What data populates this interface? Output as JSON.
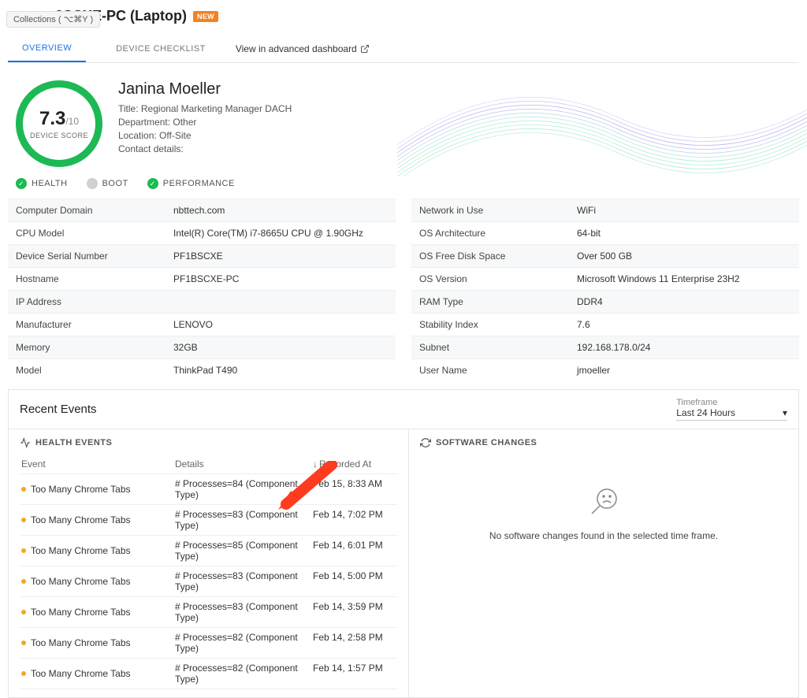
{
  "header": {
    "tooltip": "Collections ( ⌥⌘Y )",
    "device_title": "3SCXE-PC (Laptop)",
    "new_badge": "NEW"
  },
  "tabs": {
    "overview": "OVERVIEW",
    "checklist": "DEVICE CHECKLIST",
    "advanced_link": "View in advanced dashboard"
  },
  "score": {
    "value": "7.3",
    "max": "/10",
    "label": "DEVICE SCORE"
  },
  "user": {
    "name": "Janina Moeller",
    "title_line": "Title: Regional Marketing Manager DACH",
    "dept_line": "Department: Other",
    "location_line": "Location: Off-Site",
    "contact_line": "Contact details:"
  },
  "status": {
    "health": "HEALTH",
    "boot": "BOOT",
    "performance": "PERFORMANCE"
  },
  "props_left": [
    {
      "label": "Computer Domain",
      "value": "nbttech.com"
    },
    {
      "label": "CPU Model",
      "value": "Intel(R) Core(TM) i7-8665U CPU @ 1.90GHz"
    },
    {
      "label": "Device Serial Number",
      "value": "PF1BSCXE"
    },
    {
      "label": "Hostname",
      "value": "PF1BSCXE-PC"
    },
    {
      "label": "IP Address",
      "value": ""
    },
    {
      "label": "Manufacturer",
      "value": "LENOVO"
    },
    {
      "label": "Memory",
      "value": "32GB"
    },
    {
      "label": "Model",
      "value": "ThinkPad T490"
    }
  ],
  "props_right": [
    {
      "label": "Network in Use",
      "value": "WiFi"
    },
    {
      "label": "OS Architecture",
      "value": "64-bit"
    },
    {
      "label": "OS Free Disk Space",
      "value": "Over 500 GB"
    },
    {
      "label": "OS Version",
      "value": "Microsoft Windows 11 Enterprise 23H2"
    },
    {
      "label": "RAM Type",
      "value": "DDR4"
    },
    {
      "label": "Stability Index",
      "value": "7.6"
    },
    {
      "label": "Subnet",
      "value": "192.168.178.0/24"
    },
    {
      "label": "User Name",
      "value": "jmoeller"
    }
  ],
  "events_panel": {
    "title": "Recent Events",
    "timeframe_label": "Timeframe",
    "timeframe_value": "Last 24 Hours",
    "health_title": "HEALTH EVENTS",
    "changes_title": "SOFTWARE CHANGES",
    "col_event": "Event",
    "col_details": "Details",
    "col_time": "Recorded At",
    "empty_changes": "No software changes found in the selected time frame.",
    "rows": [
      {
        "event": "Too Many Chrome Tabs",
        "details": "# Processes=84 (Component Type)",
        "time": "Feb 15, 8:33 AM"
      },
      {
        "event": "Too Many Chrome Tabs",
        "details": "# Processes=83 (Component Type)",
        "time": "Feb 14, 7:02 PM"
      },
      {
        "event": "Too Many Chrome Tabs",
        "details": "# Processes=85 (Component Type)",
        "time": "Feb 14, 6:01 PM"
      },
      {
        "event": "Too Many Chrome Tabs",
        "details": "# Processes=83 (Component Type)",
        "time": "Feb 14, 5:00 PM"
      },
      {
        "event": "Too Many Chrome Tabs",
        "details": "# Processes=83 (Component Type)",
        "time": "Feb 14, 3:59 PM"
      },
      {
        "event": "Too Many Chrome Tabs",
        "details": "# Processes=82 (Component Type)",
        "time": "Feb 14, 2:58 PM"
      },
      {
        "event": "Too Many Chrome Tabs",
        "details": "# Processes=82 (Component Type)",
        "time": "Feb 14, 1:57 PM"
      }
    ]
  }
}
